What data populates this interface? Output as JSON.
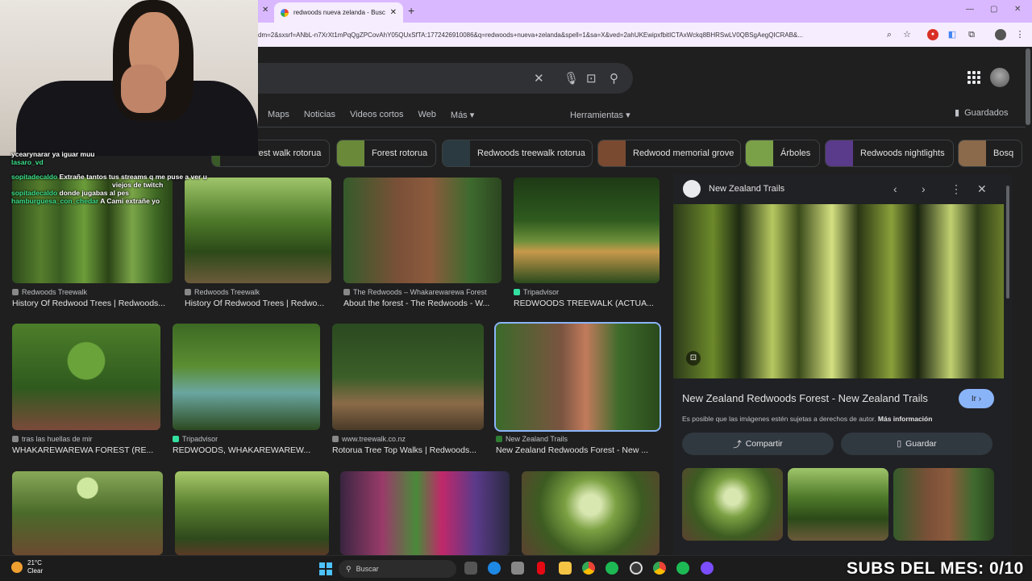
{
  "browser": {
    "tab_title": "redwoods nueva zelanda - Busc",
    "url": "dm=2&sxsrf=ANbL-n7XrXt1mPqQgZPCovAhY05QUxSfTA:1772426910086&q=redwoods+nueva+zelanda&spell=1&sa=X&ved=2ahUKEwipxfbitICTAxWckq8BHRSwLV0QBSgAegQICRAB&..."
  },
  "nav": {
    "items": [
      "Maps",
      "Noticias",
      "Videos cortos",
      "Web",
      "Más ▾"
    ],
    "tools": "Herramientas ▾",
    "saved": "Guardados"
  },
  "chips": [
    {
      "label": "rest walk rotorua",
      "color": "#3a5a28"
    },
    {
      "label": "Forest rotorua",
      "color": "#6a8a3a"
    },
    {
      "label": "Redwoods treewalk rotorua",
      "color": "#2a3a40"
    },
    {
      "label": "Redwood memorial grove",
      "color": "#7a4a30"
    },
    {
      "label": "Árboles",
      "color": "#7aa048"
    },
    {
      "label": "Redwoods nightlights",
      "color": "#5a3a8a"
    },
    {
      "label": "Bosq",
      "color": "#8a6a4a"
    }
  ],
  "results": [
    {
      "source": "Redwoods Treewalk",
      "title": "History Of Redwood Trees | Redwoods..."
    },
    {
      "source": "Redwoods Treewalk",
      "title": "History Of Redwood Trees | Redwo..."
    },
    {
      "source": "The Redwoods – Whakarewarewa Forest",
      "title": "About the forest - The Redwoods - W..."
    },
    {
      "source": "Tripadvisor",
      "title": "REDWOODS TREEWALK (ACTUA..."
    },
    {
      "source": "tras las huellas de mir",
      "title": "WHAKAREWAREWA FOREST (RE..."
    },
    {
      "source": "Tripadvisor",
      "title": "REDWOODS, WHAKAREWAREW..."
    },
    {
      "source": "www.treewalk.co.nz",
      "title": "Rotorua Tree Top Walks | Redwoods..."
    },
    {
      "source": "New Zealand Trails",
      "title": "New Zealand Redwoods Forest - New ..."
    }
  ],
  "panel": {
    "site": "New Zealand Trails",
    "title": "New Zealand Redwoods Forest - New Zealand Trails",
    "go_button": "Ir ›",
    "copyright": "Es posible que las imágenes estén sujetas a derechos de autor.",
    "more_info": "Más información",
    "share": "Compartir",
    "save": "Guardar"
  },
  "chat": [
    {
      "user": "",
      "text": "ycearynarar ya iguar muu"
    },
    {
      "user": "lasaro_vd",
      "text": ""
    },
    {
      "user": "sopitadecaldo",
      "text": "Extrañe tantos tus streams q me puse a ver u"
    },
    {
      "user": "",
      "text": "viejos de twitch"
    },
    {
      "user": "sopitadecaldo",
      "text": "donde jugabas al pes"
    },
    {
      "user": "hamburguesa_con_chedar",
      "text": "A Cami extrañe yo"
    }
  ],
  "taskbar": {
    "temp": "21°C",
    "weather": "Clear",
    "search": "Buscar",
    "overlay": "SUBS DEL MES: 0/10"
  }
}
